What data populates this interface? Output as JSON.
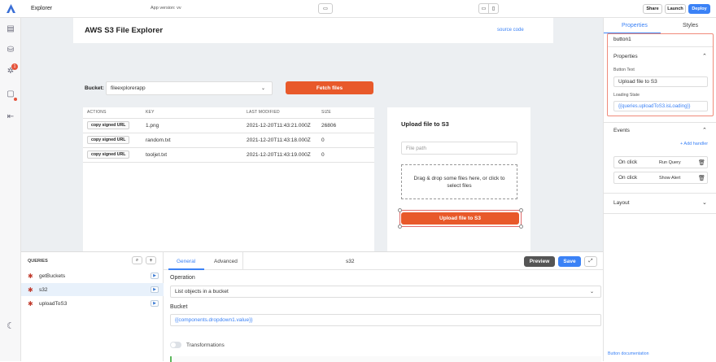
{
  "topbar": {
    "title": "Explorer",
    "app_version": "App version: vv",
    "share": "Share",
    "launch": "Launch",
    "deploy": "Deploy"
  },
  "sidebar": {
    "notification_count": "1"
  },
  "canvas": {
    "header_title": "AWS S3 File Explorer",
    "source_link": "source code",
    "bucket_label": "Bucket:",
    "bucket_value": "fileexplorerapp",
    "fetch_button": "Fetch files",
    "table": {
      "headers": [
        "ACTIONS",
        "KEY",
        "LAST MODIFIED",
        "SIZE"
      ],
      "rows": [
        {
          "action": "copy signed URL",
          "key": "1.png",
          "modified": "2021-12-20T11:43:21.000Z",
          "size": "26806"
        },
        {
          "action": "copy signed URL",
          "key": "random.txt",
          "modified": "2021-12-20T11:43:18.000Z",
          "size": "0"
        },
        {
          "action": "copy signed URL",
          "key": "tooljet.txt",
          "modified": "2021-12-20T11:43:19.000Z",
          "size": "0"
        }
      ]
    },
    "upload": {
      "title": "Upload file to S3",
      "filepath_placeholder": "File path",
      "dropzone_text": "Drag & drop some files here, or click to select files",
      "button": "Upload file to S3"
    }
  },
  "queries": {
    "title": "QUERIES",
    "items": [
      {
        "name": "getBuckets"
      },
      {
        "name": "s32"
      },
      {
        "name": "uploadToS3"
      }
    ]
  },
  "editor": {
    "tab_general": "General",
    "tab_advanced": "Advanced",
    "query_name": "s32",
    "preview": "Preview",
    "save": "Save",
    "operation_label": "Operation",
    "operation_value": "List objects in a bucket",
    "bucket_label": "Bucket",
    "bucket_value": "{{components.dropdown1.value}}",
    "transformations": "Transformations"
  },
  "props": {
    "tab_properties": "Properties",
    "tab_styles": "Styles",
    "component_name": "button1",
    "section_properties": "Properties",
    "button_text_label": "Button Text",
    "button_text_value": "Upload file to S3",
    "loading_label": "Loading State",
    "loading_value": "{{queries.uploadToS3.isLoading}}",
    "events": "Events",
    "add_handler": "+ Add handler",
    "handlers": [
      {
        "event": "On click",
        "action": "Run Query"
      },
      {
        "event": "On click",
        "action": "Show Alert"
      }
    ],
    "layout": "Layout",
    "doc_link": "Button documentation"
  },
  "colors": {
    "accent": "#3b82f6",
    "orange": "#e8592a",
    "selected": "#e8f1fb"
  }
}
